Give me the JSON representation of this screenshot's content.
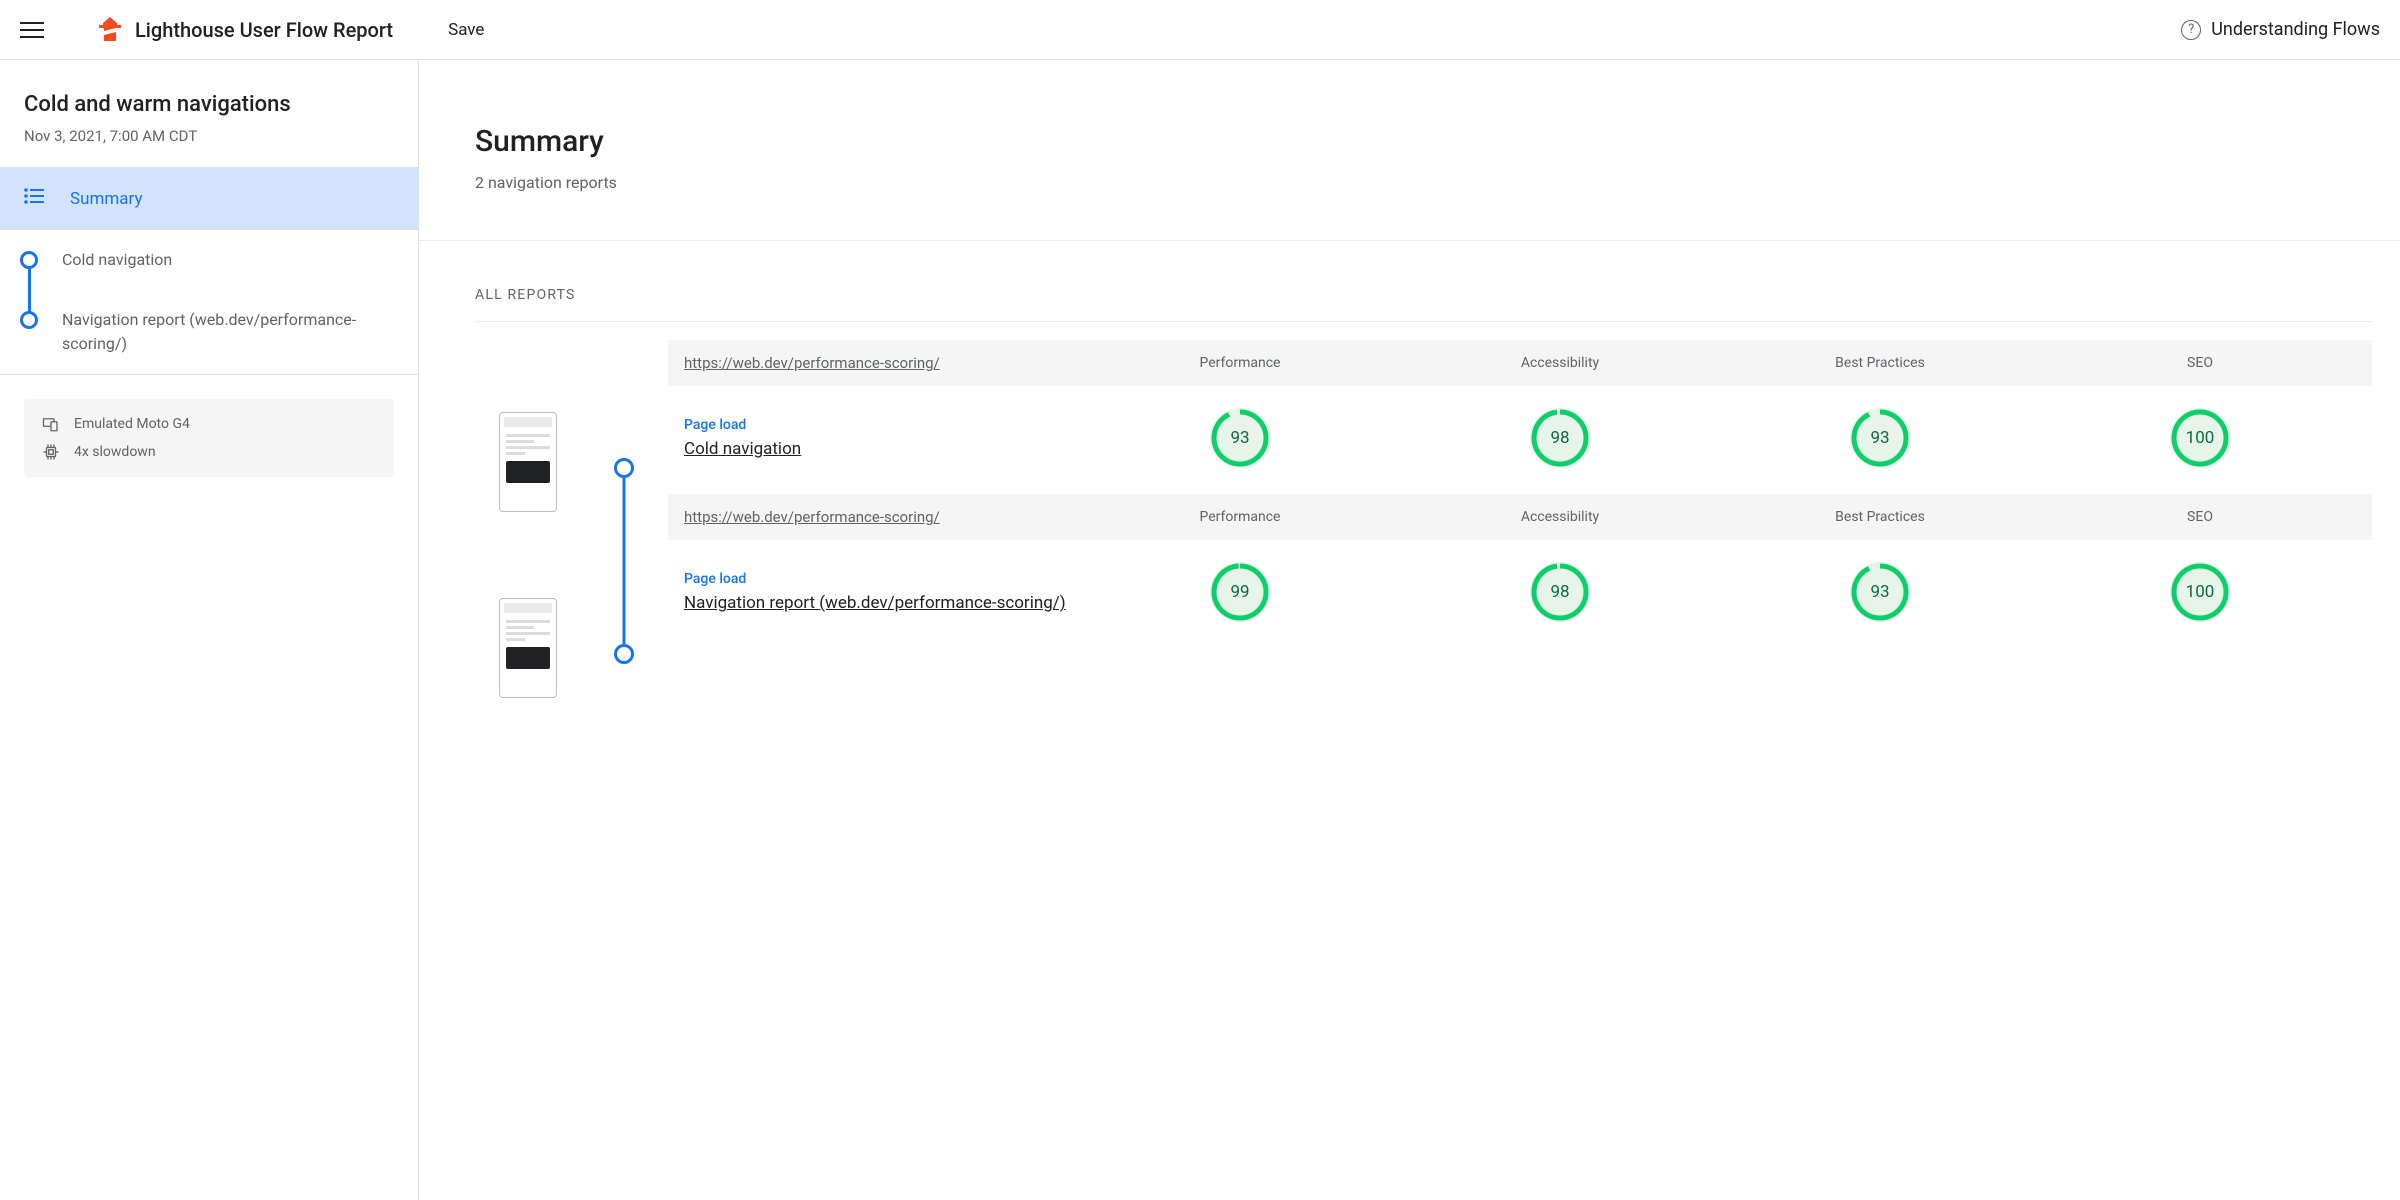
{
  "topbar": {
    "title": "Lighthouse User Flow Report",
    "save": "Save",
    "help": "Understanding Flows"
  },
  "sidebar": {
    "flow_title": "Cold and warm navigations",
    "flow_time": "Nov 3, 2021, 7:00 AM CDT",
    "summary_label": "Summary",
    "steps": [
      {
        "label": "Cold navigation"
      },
      {
        "label": "Navigation report (web.dev/performance-scoring/)"
      }
    ],
    "device": {
      "emulated": "Emulated Moto G4",
      "throttle": "4x slowdown"
    }
  },
  "main": {
    "title": "Summary",
    "subtitle": "2 navigation reports",
    "all_reports_label": "ALL REPORTS",
    "categories": [
      "Performance",
      "Accessibility",
      "Best Practices",
      "SEO"
    ],
    "reports": [
      {
        "url": "https://web.dev/performance-scoring/",
        "step_type": "Page load",
        "step_name": "Cold navigation",
        "scores": [
          93,
          98,
          93,
          100
        ]
      },
      {
        "url": "https://web.dev/performance-scoring/",
        "step_type": "Page load",
        "step_name": "Navigation report (web.dev/performance-scoring/)",
        "scores": [
          99,
          98,
          93,
          100
        ]
      }
    ]
  },
  "colors": {
    "pass_stroke": "#0cce6b",
    "pass_text": "#0c6b3d",
    "pass_bg": "#e6f4ea"
  }
}
